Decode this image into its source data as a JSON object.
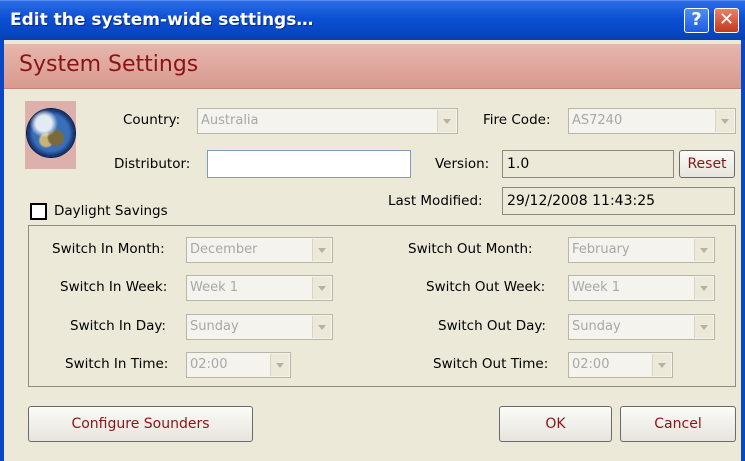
{
  "window": {
    "title": "Edit the system-wide settings…",
    "help_glyph": "?",
    "close_glyph": "✕"
  },
  "header": {
    "title": "System Settings"
  },
  "colors": {
    "title_bar": "#0b4fd3",
    "header_band": "#dea69c",
    "header_text": "#8a1414",
    "dialog_bg": "#ece9d8"
  },
  "form": {
    "country": {
      "label": "Country:",
      "value": "Australia"
    },
    "fire_code": {
      "label": "Fire Code:",
      "value": "AS7240"
    },
    "distributor": {
      "label": "Distributor:",
      "value": ""
    },
    "version": {
      "label": "Version:",
      "value": "1.0"
    },
    "reset_label": "Reset",
    "last_modified": {
      "label": "Last Modified:",
      "value": "29/12/2008 11:43:25"
    },
    "daylight_savings": {
      "label": "Daylight Savings",
      "checked": false
    }
  },
  "daylight": {
    "switch_in_month": {
      "label": "Switch In Month:",
      "value": "December"
    },
    "switch_in_week": {
      "label": "Switch In Week:",
      "value": "Week 1"
    },
    "switch_in_day": {
      "label": "Switch In Day:",
      "value": "Sunday"
    },
    "switch_in_time": {
      "label": "Switch In Time:",
      "value": "02:00"
    },
    "switch_out_month": {
      "label": "Switch Out Month:",
      "value": "February"
    },
    "switch_out_week": {
      "label": "Switch Out Week:",
      "value": "Week 1"
    },
    "switch_out_day": {
      "label": "Switch Out Day:",
      "value": "Sunday"
    },
    "switch_out_time": {
      "label": "Switch Out Time:",
      "value": "02:00"
    }
  },
  "buttons": {
    "configure_sounders": "Configure Sounders",
    "ok": "OK",
    "cancel": "Cancel"
  }
}
